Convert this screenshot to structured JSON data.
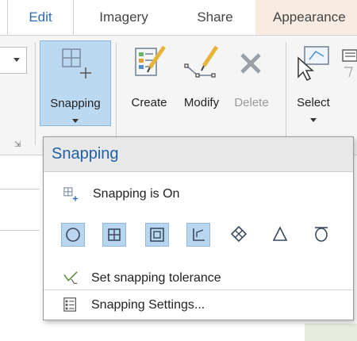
{
  "tabs": [
    {
      "label": "Edit",
      "active": true
    },
    {
      "label": "Imagery",
      "active": false
    },
    {
      "label": "Share",
      "active": false
    },
    {
      "label": "Appearance",
      "active": false
    }
  ],
  "ribbon": {
    "snapping": {
      "label": "Snapping",
      "active": true
    },
    "create": {
      "label": "Create"
    },
    "modify": {
      "label": "Modify"
    },
    "delete": {
      "label": "Delete",
      "disabled": true
    },
    "select": {
      "label": "Select"
    }
  },
  "menu": {
    "title": "Snapping",
    "snapping_on": {
      "label": "Snapping is On",
      "icon": "snapping-icon"
    },
    "modes": [
      {
        "name": "point",
        "icon": "point-snap-icon",
        "active": true
      },
      {
        "name": "endpoint",
        "icon": "endpoint-snap-icon",
        "active": true
      },
      {
        "name": "vertex",
        "icon": "vertex-snap-icon",
        "active": true
      },
      {
        "name": "edge",
        "icon": "edge-snap-icon",
        "active": true
      },
      {
        "name": "intersection",
        "icon": "intersection-snap-icon",
        "active": false
      },
      {
        "name": "midpoint",
        "icon": "midpoint-snap-icon",
        "active": false
      },
      {
        "name": "tangent",
        "icon": "tangent-snap-icon",
        "active": false
      }
    ],
    "tolerance": {
      "label": "Set snapping tolerance",
      "icon": "tolerance-icon"
    },
    "settings": {
      "label": "Snapping Settings...",
      "icon": "settings-list-icon"
    }
  },
  "colors": {
    "accent": "#1f5fa8",
    "active_fill": "#b9d6f0",
    "active_border": "#8fb8dd",
    "appearance_tab": "#f8ece2"
  }
}
